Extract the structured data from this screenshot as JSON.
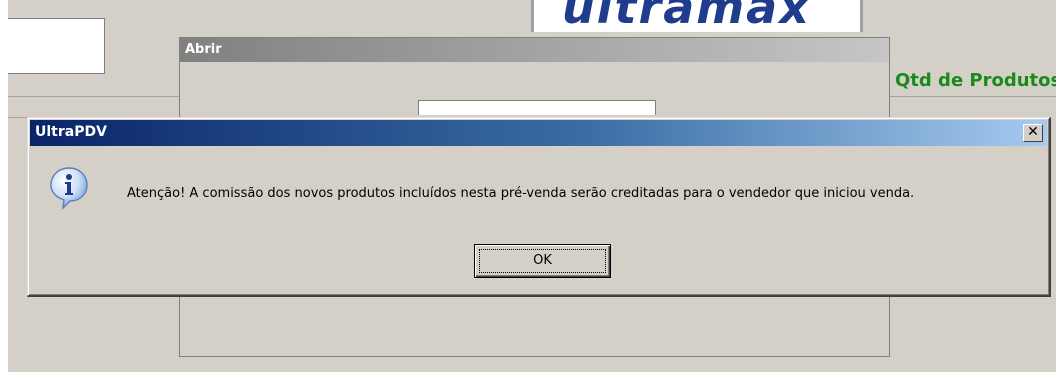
{
  "background_app": {
    "logo_text": "ultramax",
    "qtd_label": "Qtd de Produtos:",
    "abrir_dialog": {
      "title": "Abrir"
    }
  },
  "message_box": {
    "title": "UltraPDV",
    "close_glyph": "✕",
    "icon": "info-icon",
    "message": "Atenção! A comissão dos novos produtos incluídos nesta pré-venda serão creditadas para o vendedor que iniciou venda.",
    "ok_label": "OK"
  },
  "colors": {
    "window_face": "#d4d0c8",
    "title_active_start": "#0a246a",
    "title_active_end": "#a6caf0",
    "accent_green": "#1a8a1a",
    "logo_blue": "#1f3d8c"
  }
}
